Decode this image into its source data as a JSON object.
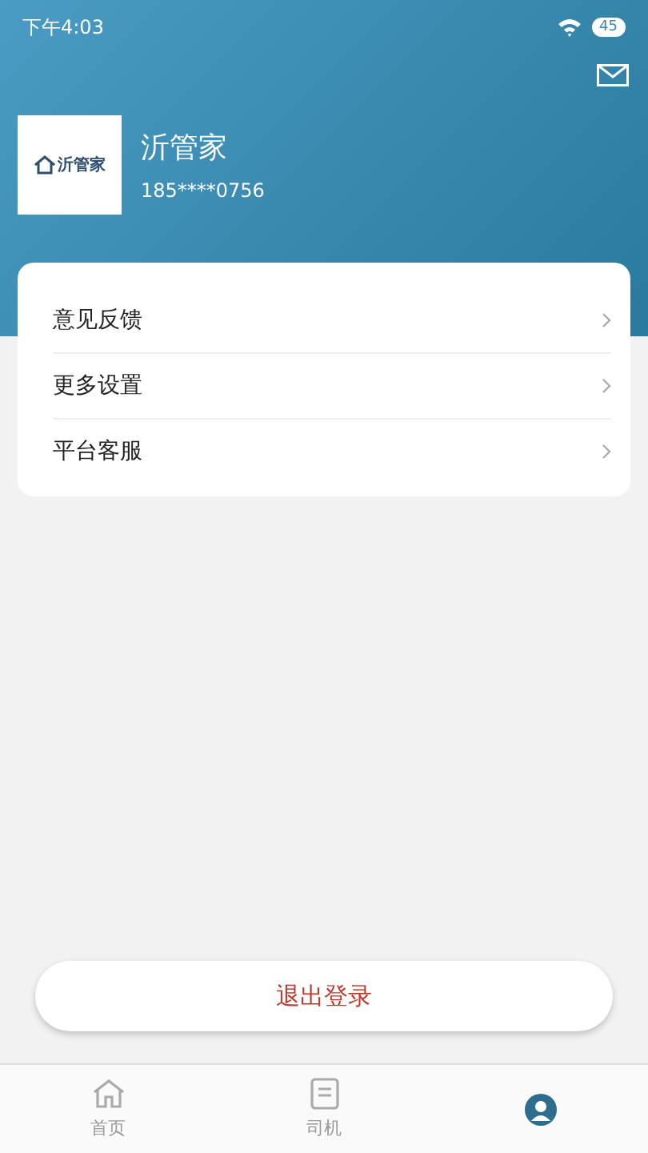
{
  "status_bar": {
    "time": "下午4:03",
    "battery": "45"
  },
  "profile": {
    "logo_text": "沂管家",
    "name": "沂管家",
    "phone": "185****0756"
  },
  "menu": [
    {
      "label": "意见反馈"
    },
    {
      "label": "更多设置"
    },
    {
      "label": "平台客服"
    }
  ],
  "logout_button": "退出登录",
  "tabs": [
    {
      "label": "首页",
      "selected": false
    },
    {
      "label": "司机",
      "selected": false
    },
    {
      "selected": true
    }
  ]
}
